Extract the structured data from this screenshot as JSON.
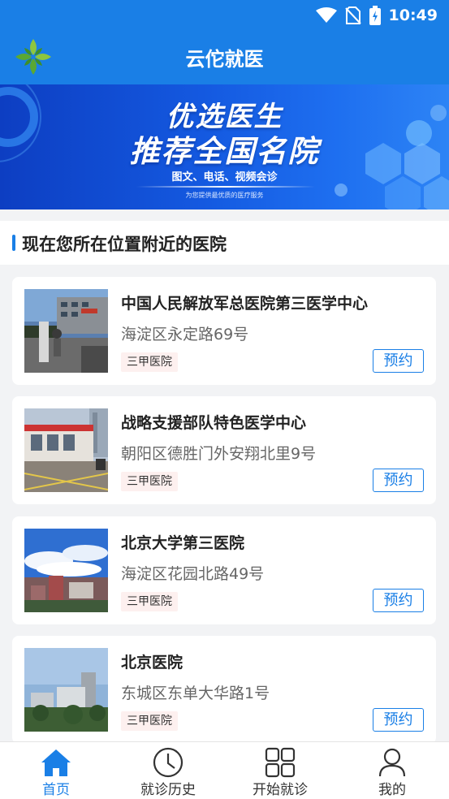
{
  "status": {
    "time": "10:49"
  },
  "header": {
    "title": "云佗就医"
  },
  "banner": {
    "line1": "优选医生",
    "line2": "推荐全国名院",
    "subtitle": "图文、电话、视频会诊",
    "tagline": "为您提供最优质的医疗服务"
  },
  "section": {
    "title": "现在您所在位置附近的医院"
  },
  "hospitals": [
    {
      "name": "中国人民解放军总医院第三医学中心",
      "address": "海淀区永定路69号",
      "level": "三甲医院",
      "action": "预约"
    },
    {
      "name": "战略支援部队特色医学中心",
      "address": "朝阳区德胜门外安翔北里9号",
      "level": "三甲医院",
      "action": "预约"
    },
    {
      "name": "北京大学第三医院",
      "address": "海淀区花园北路49号",
      "level": "三甲医院",
      "action": "预约"
    },
    {
      "name": "北京医院",
      "address": "东城区东单大华路1号",
      "level": "三甲医院",
      "action": "预约"
    }
  ],
  "tabs": [
    {
      "label": "首页",
      "icon": "home-icon",
      "active": true
    },
    {
      "label": "就诊历史",
      "icon": "clock-icon",
      "active": false
    },
    {
      "label": "开始就诊",
      "icon": "grid-icon",
      "active": false
    },
    {
      "label": "我的",
      "icon": "person-icon",
      "active": false
    }
  ],
  "colors": {
    "primary": "#1a7fe6",
    "tag_bg": "#fdf0ef"
  }
}
